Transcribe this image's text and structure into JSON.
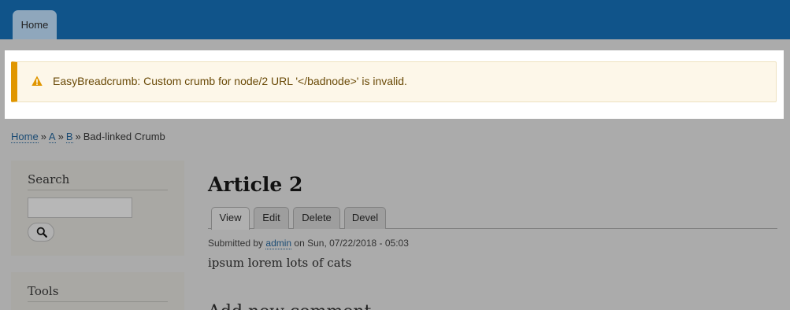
{
  "header": {
    "home_tab": "Home"
  },
  "message": {
    "type": "warning",
    "icon": "warning-icon",
    "text": "EasyBreadcrumb: Custom crumb for node/2 URL '</badnode>' is invalid."
  },
  "breadcrumb": {
    "items": [
      {
        "label": "Home",
        "link": true
      },
      {
        "label": "A",
        "link": true
      },
      {
        "label": "B",
        "link": true
      },
      {
        "label": "Bad-linked Crumb",
        "link": false
      }
    ],
    "separator": "»"
  },
  "sidebar": {
    "search": {
      "title": "Search",
      "input_value": "",
      "button_icon": "search-icon"
    },
    "tools": {
      "title": "Tools"
    }
  },
  "article": {
    "title": "Article 2",
    "tabs": [
      {
        "label": "View",
        "active": true
      },
      {
        "label": "Edit",
        "active": false
      },
      {
        "label": "Delete",
        "active": false
      },
      {
        "label": "Devel",
        "active": false
      }
    ],
    "submitted_prefix": "Submitted by",
    "author": "admin",
    "submitted_suffix": "on Sun, 07/22/2018 - 05:03",
    "body": "ipsum lorem lots of cats",
    "comment_heading": "Add new comment"
  },
  "colors": {
    "header_bg": "#10548a",
    "overlay_bg": "#ababab",
    "warning_accent": "#e09600",
    "link": "#1a4b74"
  }
}
